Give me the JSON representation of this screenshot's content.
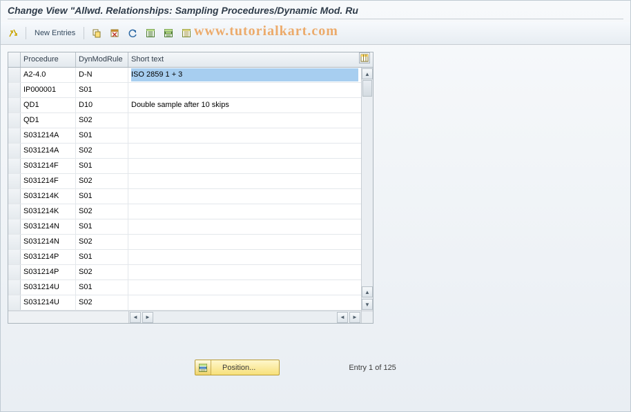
{
  "title": "Change View \"Allwd. Relationships: Sampling Procedures/Dynamic Mod. Ru",
  "watermark": "www.tutorialkart.com",
  "toolbar": {
    "new_entries_label": "New Entries"
  },
  "icons": {
    "other_view": "other-view-icon",
    "copy": "copy-icon",
    "delete": "delete-icon",
    "undo": "undo-icon",
    "select_all": "select-all-icon",
    "select_block": "select-block-icon",
    "deselect_all": "deselect-all-icon"
  },
  "grid": {
    "columns": {
      "procedure": "Procedure",
      "dynmodrule": "DynModRule",
      "short_text": "Short text"
    },
    "rows": [
      {
        "procedure": "A2-4.0",
        "rule": "D-N",
        "text": "ISO 2859 1 + 3",
        "selected": true
      },
      {
        "procedure": "IP000001",
        "rule": "S01",
        "text": ""
      },
      {
        "procedure": "QD1",
        "rule": "D10",
        "text": "Double sample after 10 skips"
      },
      {
        "procedure": "QD1",
        "rule": "S02",
        "text": ""
      },
      {
        "procedure": "S031214A",
        "rule": "S01",
        "text": ""
      },
      {
        "procedure": "S031214A",
        "rule": "S02",
        "text": ""
      },
      {
        "procedure": "S031214F",
        "rule": "S01",
        "text": ""
      },
      {
        "procedure": "S031214F",
        "rule": "S02",
        "text": ""
      },
      {
        "procedure": "S031214K",
        "rule": "S01",
        "text": ""
      },
      {
        "procedure": "S031214K",
        "rule": "S02",
        "text": ""
      },
      {
        "procedure": "S031214N",
        "rule": "S01",
        "text": ""
      },
      {
        "procedure": "S031214N",
        "rule": "S02",
        "text": ""
      },
      {
        "procedure": "S031214P",
        "rule": "S01",
        "text": ""
      },
      {
        "procedure": "S031214P",
        "rule": "S02",
        "text": ""
      },
      {
        "procedure": "S031214U",
        "rule": "S01",
        "text": ""
      },
      {
        "procedure": "S031214U",
        "rule": "S02",
        "text": ""
      }
    ]
  },
  "footer": {
    "position_label": "Position...",
    "entry_info": "Entry 1 of 125"
  }
}
